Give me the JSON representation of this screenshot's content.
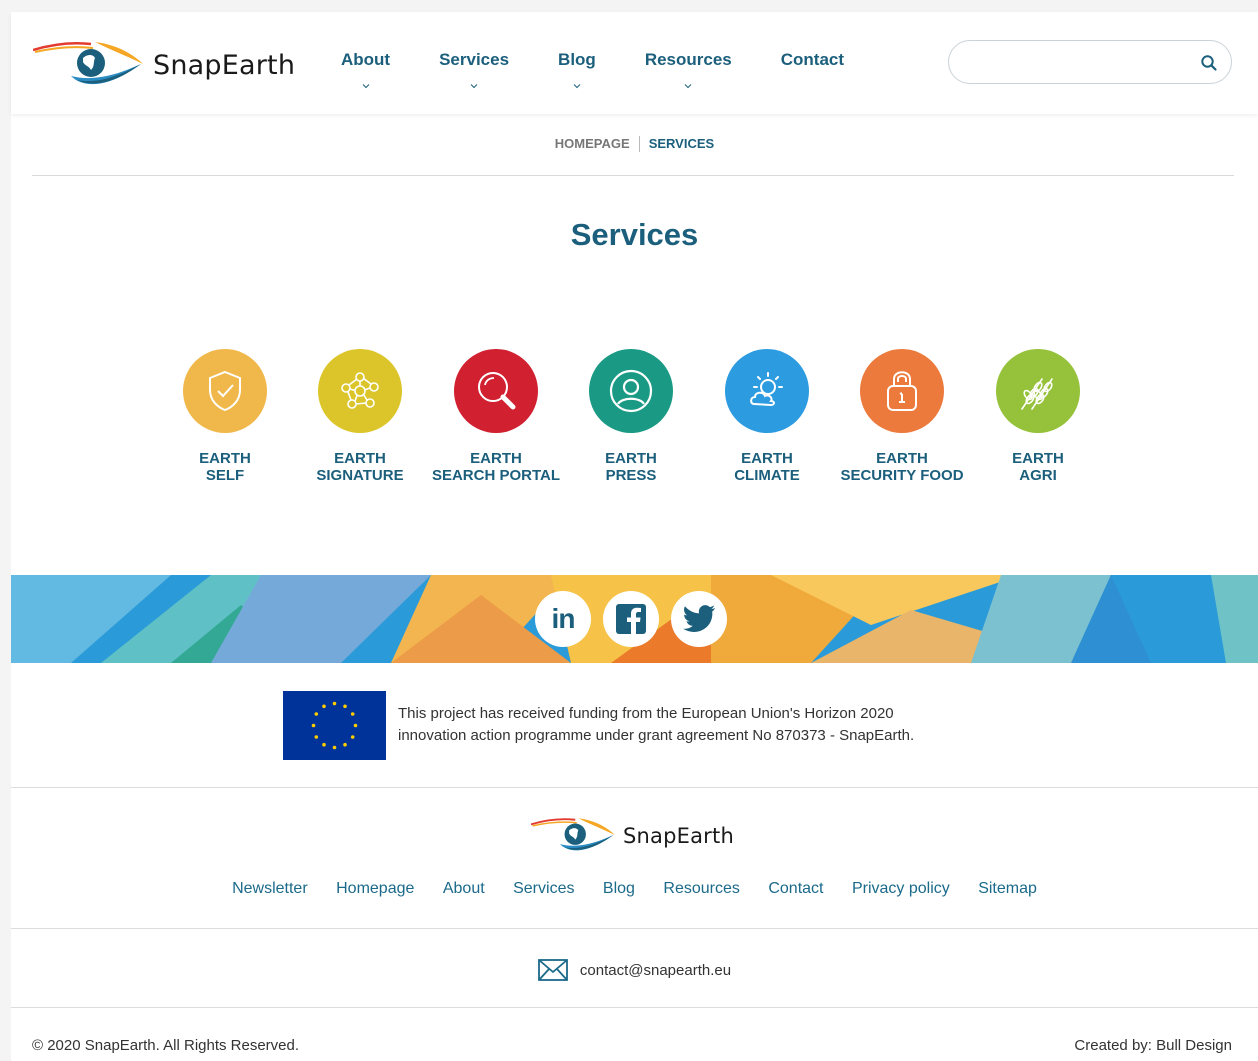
{
  "brand": {
    "name": "SnapEarth",
    "accent": "#1b5f7c",
    "link_color": "#1b6a8a"
  },
  "nav": {
    "items": [
      {
        "label": "About",
        "has_dropdown": true
      },
      {
        "label": "Services",
        "has_dropdown": true
      },
      {
        "label": "Blog",
        "has_dropdown": true
      },
      {
        "label": "Resources",
        "has_dropdown": true
      },
      {
        "label": "Contact",
        "has_dropdown": false
      }
    ]
  },
  "search": {
    "placeholder": "",
    "value": "",
    "icon": "search-icon"
  },
  "breadcrumb": {
    "home": "HOMEPAGE",
    "current": "SERVICES"
  },
  "page": {
    "title": "Services"
  },
  "services": [
    {
      "line1": "EARTH",
      "line2": "SELF",
      "color": "#f0b84a",
      "icon": "shield-check-icon"
    },
    {
      "line1": "EARTH",
      "line2": "SIGNATURE",
      "color": "#dcc52a",
      "icon": "network-nodes-icon"
    },
    {
      "line1": "EARTH",
      "line2": "SEARCH PORTAL",
      "color": "#d12030",
      "icon": "magnifier-icon"
    },
    {
      "line1": "EARTH",
      "line2": "PRESS",
      "color": "#1a9a85",
      "icon": "user-circle-icon"
    },
    {
      "line1": "EARTH",
      "line2": "CLIMATE",
      "color": "#2c9be0",
      "icon": "sun-cloud-icon"
    },
    {
      "line1": "EARTH",
      "line2": "SECURITY FOOD",
      "color": "#ec7a3c",
      "icon": "padlock-icon"
    },
    {
      "line1": "EARTH",
      "line2": "AGRI",
      "color": "#95c23a",
      "icon": "wheat-icon"
    }
  ],
  "social": [
    {
      "name": "LinkedIn",
      "glyph": "in",
      "icon": "linkedin-icon"
    },
    {
      "name": "Facebook",
      "glyph": "f",
      "icon": "facebook-icon"
    },
    {
      "name": "Twitter",
      "glyph": "",
      "icon": "twitter-icon"
    }
  ],
  "funding": {
    "line1": "This project has received funding from the European Union's Horizon 2020",
    "line2": "innovation action programme under grant agreement No 870373 - SnapEarth."
  },
  "footer": {
    "links": [
      "Newsletter",
      "Homepage",
      "About",
      "Services",
      "Blog",
      "Resources",
      "Contact",
      "Privacy policy",
      "Sitemap"
    ],
    "email": "contact@snapearth.eu",
    "copyright": "© 2020 SnapEarth. All Rights Reserved.",
    "credits": "Created by: Bull Design"
  }
}
